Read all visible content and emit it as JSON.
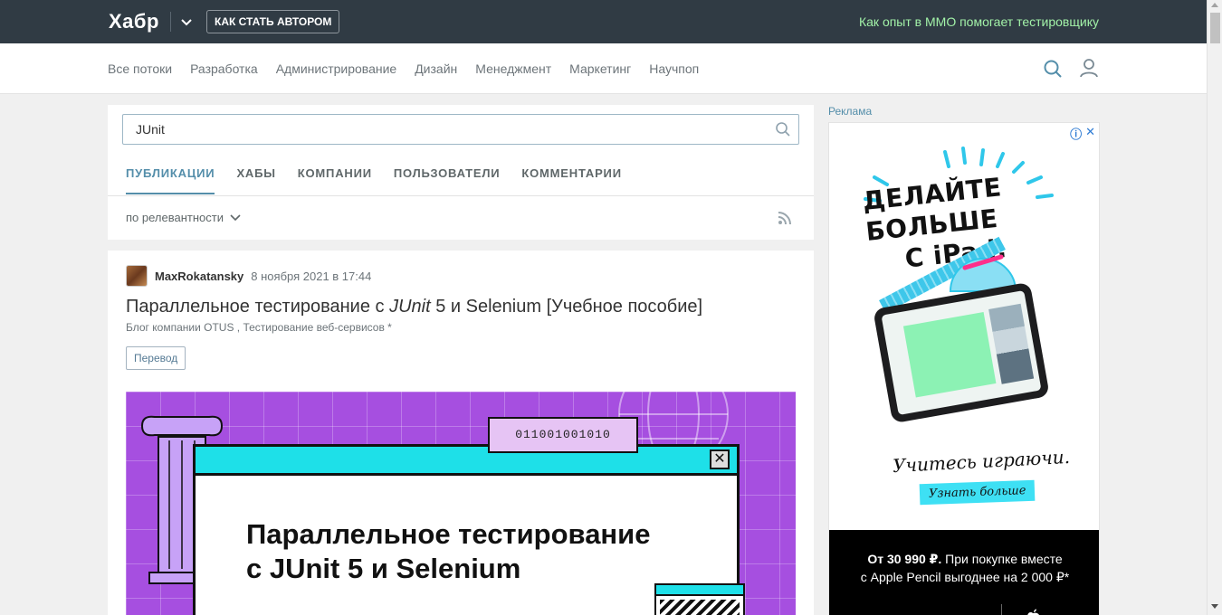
{
  "topbar": {
    "logo": "Хабр",
    "author_button": "КАК СТАТЬ АВТОРОМ",
    "promo_link": "Как опыт в MMO помогает тестировщику"
  },
  "nav": {
    "items": [
      {
        "label": "Все потоки"
      },
      {
        "label": "Разработка"
      },
      {
        "label": "Администрирование"
      },
      {
        "label": "Дизайн"
      },
      {
        "label": "Менеджмент"
      },
      {
        "label": "Маркетинг"
      },
      {
        "label": "Научпоп"
      }
    ]
  },
  "search": {
    "value": "JUnit",
    "tabs": [
      {
        "label": "ПУБЛИКАЦИИ",
        "active": true
      },
      {
        "label": "ХАБЫ"
      },
      {
        "label": "КОМПАНИИ"
      },
      {
        "label": "ПОЛЬЗОВАТЕЛИ"
      },
      {
        "label": "КОММЕНТАРИИ"
      }
    ],
    "sort": "по релевантности"
  },
  "article": {
    "author": "MaxRokatansky",
    "date": "8 ноября 2021 в 17:44",
    "title_before": "Параллельное тестирование с ",
    "title_em": "JUnit",
    "title_after": " 5 и Selenium [Учебное пособие]",
    "hubs": "Блог компании OTUS , Тестирование веб-сервисов *",
    "label": "Перевод",
    "cover": {
      "binary": "011001001010",
      "title_line1": "Параллельное тестирование",
      "title_line2": "с JUnit 5 и Selenium",
      "close": "✕"
    }
  },
  "ad": {
    "label": "Реклама",
    "badge_info": "ⓘ",
    "badge_close": "✕",
    "headline_line1": "ДЕЛАЙТЕ БОЛЬШЕ",
    "headline_line2": "С iPad.",
    "script": "Учитесь играючи.",
    "cta": "Узнать больше",
    "footer_price": "От 30 990 ₽.",
    "footer_line1_rest": " При покупке вместе",
    "footer_line2": "с Apple Pencil выгоднее на 2 000 ₽*"
  },
  "colors": {
    "topbar_bg": "#303b44",
    "promo_link": "#a2f2a8",
    "accent": "#548eaa",
    "cover_bg": "#a64fe0",
    "cover_cyan": "#1ee0e8"
  },
  "icons": {
    "logo_menu": "chevron-down-icon",
    "nav_search": "search-icon",
    "nav_user": "user-icon",
    "search_submit": "search-icon",
    "sort": "chevron-down-icon",
    "rss": "rss-icon",
    "ad_brand": "apple-icon"
  }
}
